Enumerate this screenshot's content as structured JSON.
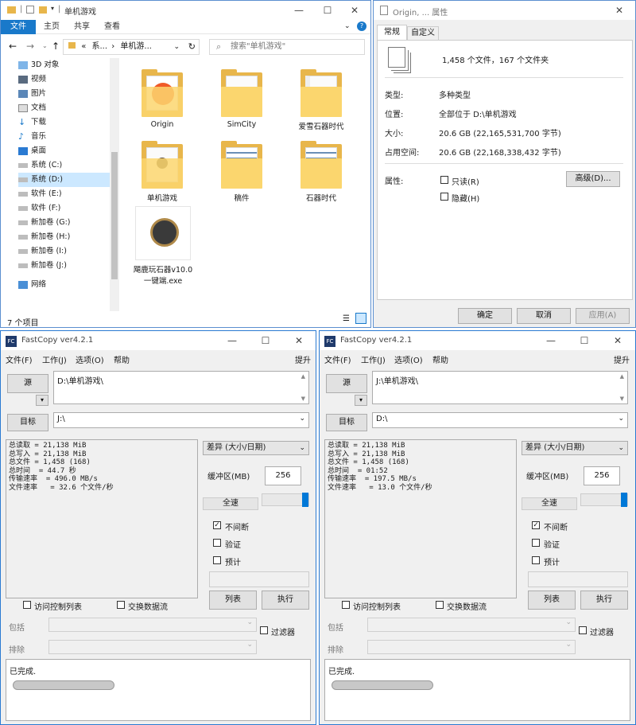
{
  "explorer": {
    "title": "单机游戏",
    "ribbon_tabs": [
      "文件",
      "主页",
      "共享",
      "查看"
    ],
    "address": [
      "«",
      "系...",
      "单机游...",
      "›"
    ],
    "search_placeholder": "搜索\"单机游戏\"",
    "tree": [
      "3D 对象",
      "视频",
      "图片",
      "文档",
      "下载",
      "音乐",
      "桌面",
      "系统 (C:)",
      "系统 (D:)",
      "软件 (E:)",
      "软件 (F:)",
      "新加卷 (G:)",
      "新加卷 (H:)",
      "新加卷 (I:)",
      "新加卷 (J:)",
      "网络"
    ],
    "items": [
      {
        "name": "Origin",
        "kind": "folder-origin"
      },
      {
        "name": "SimCity",
        "kind": "folder-plain"
      },
      {
        "name": "爱雪石器时代",
        "kind": "folder-doc"
      },
      {
        "name": "单机游戏",
        "kind": "folder-thumb"
      },
      {
        "name": "稿件",
        "kind": "folder-striped"
      },
      {
        "name": "石器时代",
        "kind": "folder-striped"
      },
      {
        "name": "飓鹿玩石器v10.0一键端.exe",
        "kind": "exe"
      }
    ],
    "status": "7 个项目"
  },
  "props": {
    "title": "Origin, ... 属性",
    "tabs": [
      "常规",
      "自定义"
    ],
    "summary": "1,458 个文件，167 个文件夹",
    "rows": [
      {
        "label": "类型:",
        "value": "多种类型"
      },
      {
        "label": "位置:",
        "value": "全部位于 D:\\单机游戏"
      },
      {
        "label": "大小:",
        "value": "20.6 GB (22,165,531,700 字节)"
      },
      {
        "label": "占用空间:",
        "value": "20.6 GB (22,168,338,432 字节)"
      }
    ],
    "attr_label": "属性:",
    "readonly": "只读(R)",
    "hidden": "隐藏(H)",
    "advanced": "高级(D)...",
    "ok": "确定",
    "cancel": "取消",
    "apply": "应用(A)"
  },
  "fastcopy": [
    {
      "title": "FastCopy ver4.2.1",
      "menu": [
        "文件(F)",
        "工作(J)",
        "选项(O)",
        "帮助"
      ],
      "upgrade": "提升",
      "src_label": "源",
      "src": "D:\\单机游戏\\",
      "dst_label": "目标",
      "dst": "J:\\",
      "stats": [
        "总读取 = 21,138 MiB",
        "总写入 = 21,138 MiB",
        "总文件 = 1,458 (168)",
        "总时间  = 44.7 秒",
        "传输速率  = 496.0 MB/s",
        "文件速率   = 32.6 个文件/秒"
      ],
      "mode": "差异 (大小/日期)",
      "buf_label": "缓冲区(MB)",
      "buf": "256",
      "fullspeed": "全速",
      "nonstop": "不间断",
      "verify": "验证",
      "estimate": "预计",
      "acl": "访问控制列表",
      "stream": "交换数据流",
      "list_btn": "列表",
      "exec_btn": "执行",
      "include": "包括",
      "exclude": "排除",
      "filter": "过滤器",
      "status": "已完成."
    },
    {
      "title": "FastCopy ver4.2.1",
      "menu": [
        "文件(F)",
        "工作(J)",
        "选项(O)",
        "帮助"
      ],
      "upgrade": "提升",
      "src_label": "源",
      "src": "J:\\单机游戏\\",
      "dst_label": "目标",
      "dst": "D:\\",
      "stats": [
        "总读取 = 21,138 MiB",
        "总写入 = 21,138 MiB",
        "总文件 = 1,458 (168)",
        "总时间  = 01:52",
        "传输速率  = 197.5 MB/s",
        "文件速率   = 13.0 个文件/秒"
      ],
      "mode": "差异 (大小/日期)",
      "buf_label": "缓冲区(MB)",
      "buf": "256",
      "fullspeed": "全速",
      "nonstop": "不间断",
      "verify": "验证",
      "estimate": "预计",
      "acl": "访问控制列表",
      "stream": "交换数据流",
      "list_btn": "列表",
      "exec_btn": "执行",
      "include": "包括",
      "exclude": "排除",
      "filter": "过滤器",
      "status": "已完成."
    }
  ]
}
